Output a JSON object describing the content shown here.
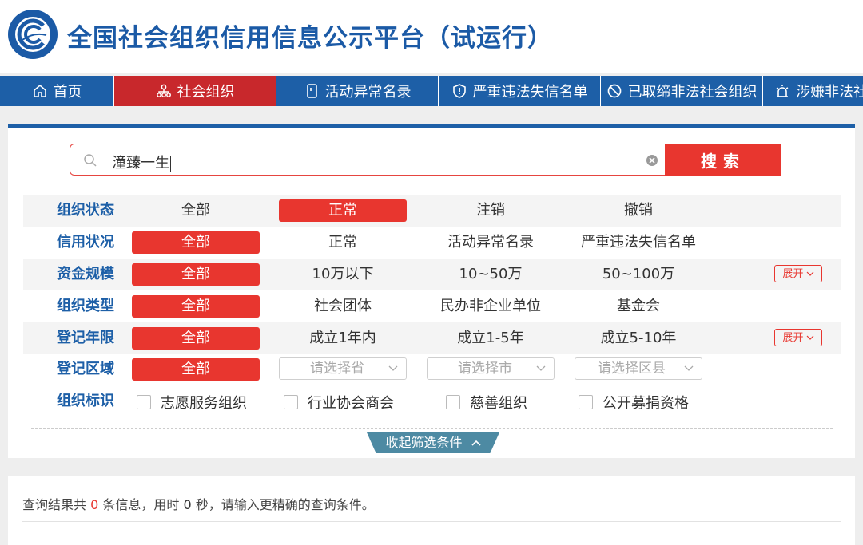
{
  "header": {
    "title": "全国社会组织信用信息公示平台（试运行）"
  },
  "nav": [
    {
      "label": "首页",
      "icon": "home-icon"
    },
    {
      "label": "社会组织",
      "icon": "org-chart-icon"
    },
    {
      "label": "活动异常名录",
      "icon": "document-icon"
    },
    {
      "label": "严重违法失信名单",
      "icon": "shield-alert-icon"
    },
    {
      "label": "已取缔非法社会组织",
      "icon": "ban-icon"
    },
    {
      "label": "涉嫌非法社",
      "icon": "alarm-icon"
    }
  ],
  "search": {
    "value": "潼臻一生",
    "button": "搜索"
  },
  "filters": {
    "status": {
      "label": "组织状态",
      "options": [
        "全部",
        "正常",
        "注销",
        "撤销"
      ]
    },
    "credit": {
      "label": "信用状况",
      "options": [
        "全部",
        "正常",
        "活动异常名录",
        "严重违法失信名单"
      ]
    },
    "capital": {
      "label": "资金规模",
      "options": [
        "全部",
        "10万以下",
        "10~50万",
        "50~100万"
      ],
      "expand": "展开"
    },
    "type": {
      "label": "组织类型",
      "options": [
        "全部",
        "社会团体",
        "民办非企业单位",
        "基金会"
      ]
    },
    "years": {
      "label": "登记年限",
      "options": [
        "全部",
        "成立1年内",
        "成立1-5年",
        "成立5-10年"
      ],
      "expand": "展开"
    },
    "region": {
      "label": "登记区域",
      "all": "全部",
      "province": "请选择省",
      "city": "请选择市",
      "county": "请选择区县"
    },
    "marks": {
      "label": "组织标识",
      "options": [
        "志愿服务组织",
        "行业协会商会",
        "慈善组织",
        "公开募捐资格"
      ]
    }
  },
  "collapse_label": "收起筛选条件",
  "result": {
    "prefix": "查询结果共",
    "count": "0",
    "mid": "条信息，用时",
    "seconds": "0",
    "suffix": "秒，请输入更精确的查询条件。"
  },
  "colors": {
    "brand_blue": "#1d5fa7",
    "accent_red": "#e8362f",
    "tab_teal": "#4d8aa3"
  }
}
